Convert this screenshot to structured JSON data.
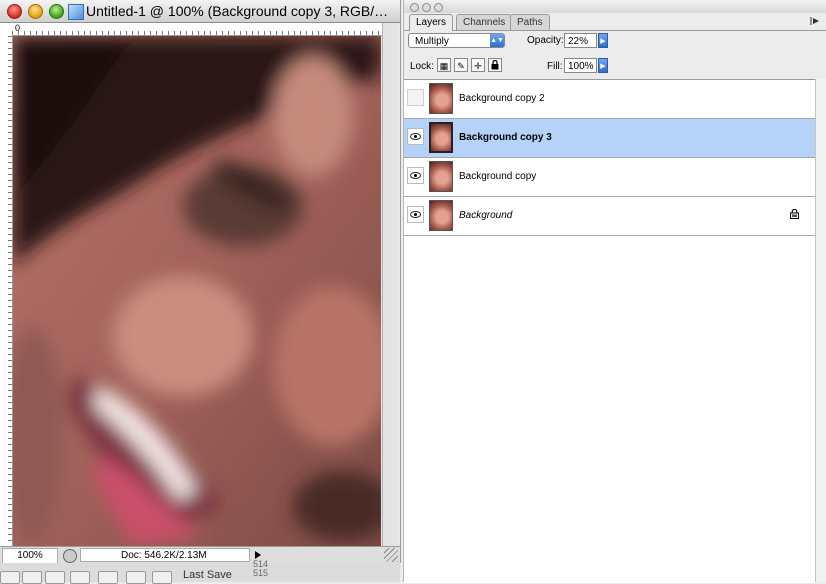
{
  "document": {
    "title": "Untitled-1 @ 100% (Background copy 3, RGB/…",
    "ruler_origin": "0",
    "zoom": "100%",
    "doc_size": "Doc: 546.2K/2.13M"
  },
  "background_app": {
    "last_save": "Last Save",
    "numbers": [
      "514",
      "515"
    ]
  },
  "layers_palette": {
    "tabs": [
      "Layers",
      "Channels",
      "Paths"
    ],
    "active_tab": "Layers",
    "blend_mode": "Multiply",
    "opacity_label": "Opacity:",
    "opacity": "22%",
    "lock_label": "Lock:",
    "fill_label": "Fill:",
    "fill": "100%",
    "layers": [
      {
        "name": "Background copy 2",
        "visible": false,
        "selected": false,
        "italic": false,
        "locked": false
      },
      {
        "name": "Background copy 3",
        "visible": true,
        "selected": true,
        "italic": false,
        "locked": false
      },
      {
        "name": "Background copy",
        "visible": true,
        "selected": false,
        "italic": false,
        "locked": false
      },
      {
        "name": "Background",
        "visible": true,
        "selected": false,
        "italic": true,
        "locked": true
      }
    ]
  },
  "icons": {
    "close": "close-icon",
    "minimize": "minimize-icon",
    "zoom": "zoom-icon",
    "eye": "eye-icon",
    "lock": "lock-icon",
    "palette_menu": "palette-menu-icon"
  },
  "colors": {
    "selection": "#b5d3f8",
    "accent": "#2f6ecc"
  }
}
